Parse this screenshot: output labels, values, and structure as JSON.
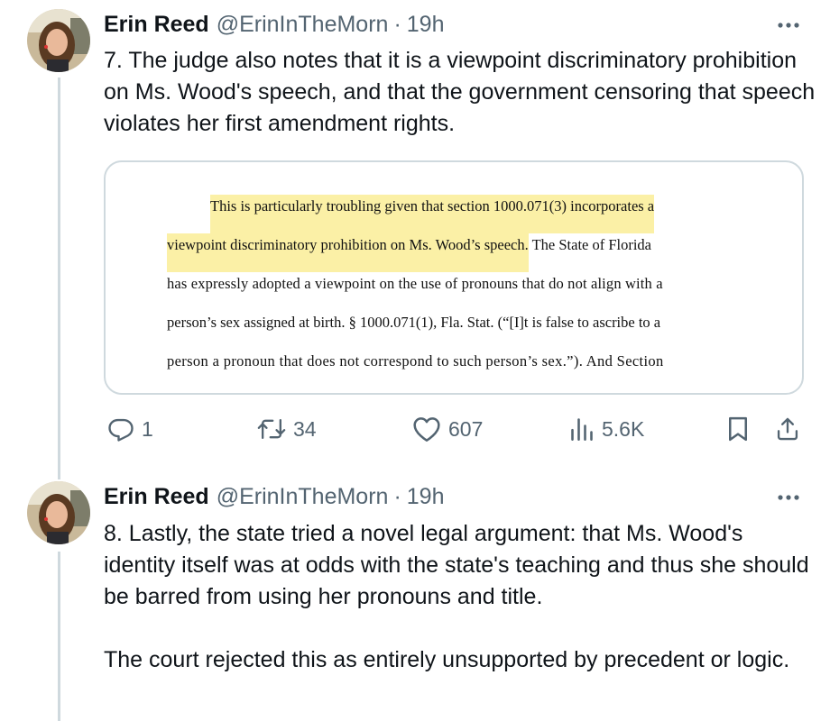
{
  "tweets": [
    {
      "author_name": "Erin Reed",
      "handle": "@ErinInTheMorn",
      "separator": "·",
      "time": "19h",
      "paragraphs": [
        "7. The judge also notes that it is a viewpoint discriminatory prohibition on Ms. Wood's speech, and that the government censoring that speech violates her first amendment rights."
      ],
      "embed": {
        "lines": [
          {
            "highlight": "This is particularly troubling given that section 1000.071(3) incorporates a",
            "rest": ""
          },
          {
            "highlight": "viewpoint discriminatory prohibition on Ms. Wood’s speech.",
            "rest": " The State of Florida"
          },
          {
            "highlight": "",
            "rest": "has expressly adopted a viewpoint on the use of pronouns that do not align with a"
          },
          {
            "highlight": "",
            "rest": "person’s sex assigned at birth. § 1000.071(1), Fla. Stat. (“[I]t is false to ascribe to a"
          },
          {
            "highlight": "",
            "rest": "person a pronoun that does not correspond to such person’s sex.”). And Section"
          }
        ]
      },
      "actions": {
        "replies": "1",
        "reposts": "34",
        "likes": "607",
        "views": "5.6K"
      }
    },
    {
      "author_name": "Erin Reed",
      "handle": "@ErinInTheMorn",
      "separator": "·",
      "time": "19h",
      "paragraphs": [
        "8. Lastly, the state tried a novel legal argument: that Ms. Wood's identity itself was at odds with the state's teaching and thus she should be barred from using her pronouns and title.",
        "The court rejected this as entirely unsupported by precedent or logic."
      ]
    }
  ],
  "icons": {
    "more": "more-horizontal-icon",
    "reply": "reply-icon",
    "repost": "repost-icon",
    "like": "heart-icon",
    "views": "views-chart-icon",
    "bookmark": "bookmark-icon",
    "share": "share-icon"
  },
  "colors": {
    "text": "#0f1419",
    "secondary": "#536471",
    "thread_line": "#cfd9de",
    "highlight": "#fbf0a6"
  }
}
